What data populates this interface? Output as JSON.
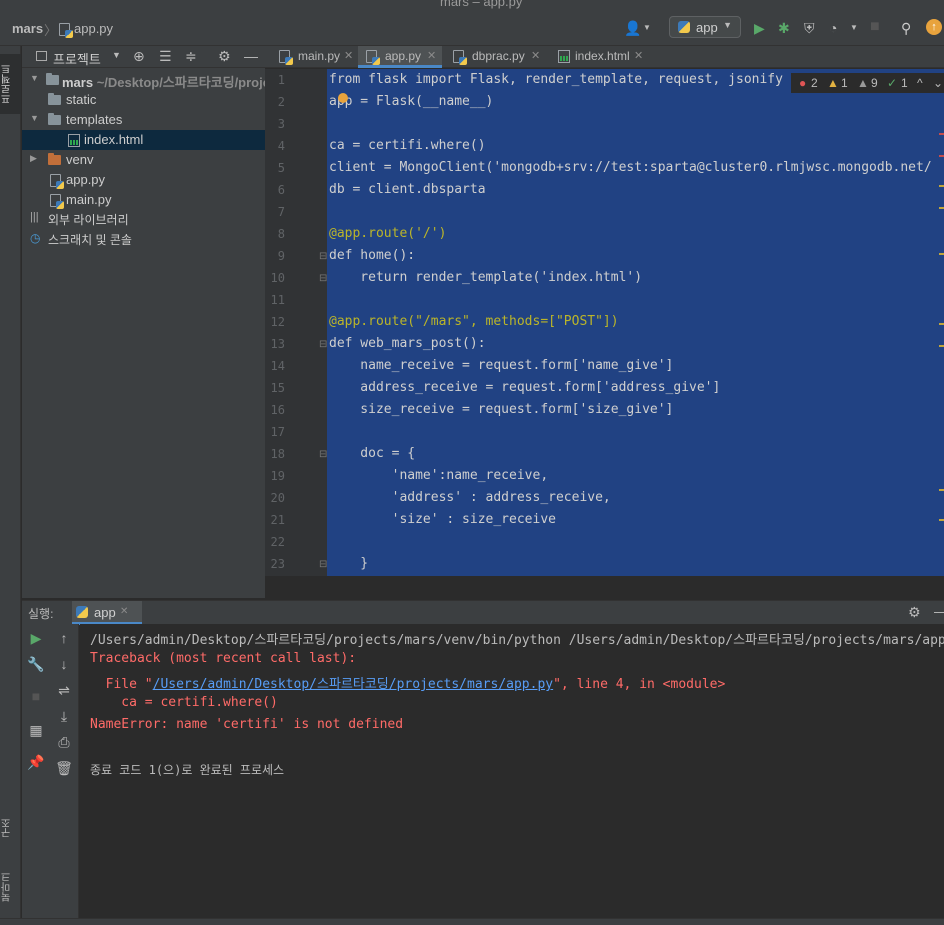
{
  "window": {
    "title": "mars – app.py"
  },
  "navbar": {
    "project": "mars",
    "file": "app.py",
    "run_config": "app"
  },
  "sidebar": {
    "tabs": {
      "project": "프로젝트",
      "structure": "구조",
      "bookmarks": "북마크"
    }
  },
  "project_panel": {
    "title": "프로젝트",
    "root": {
      "name": "mars",
      "path": "~/Desktop/스파르타코딩/project"
    },
    "items": [
      {
        "name": "static"
      },
      {
        "name": "templates"
      },
      {
        "name": "index.html"
      },
      {
        "name": "venv"
      },
      {
        "name": "app.py"
      },
      {
        "name": "main.py"
      },
      {
        "name": "외부 라이브러리"
      },
      {
        "name": "스크래치 및 콘솔"
      }
    ]
  },
  "editor": {
    "tabs": [
      {
        "label": "main.py"
      },
      {
        "label": "app.py"
      },
      {
        "label": "dbprac.py"
      },
      {
        "label": "index.html"
      }
    ],
    "inspections": {
      "errors": "2",
      "warnings": "1",
      "weak_warnings": "9",
      "typos": "1"
    },
    "line_numbers": [
      "1",
      "2",
      "3",
      "4",
      "5",
      "6",
      "7",
      "8",
      "9",
      "10",
      "11",
      "12",
      "13",
      "14",
      "15",
      "16",
      "17",
      "18",
      "19",
      "20",
      "21",
      "22",
      "23"
    ],
    "code": [
      "from flask import Flask, render_template, request, jsonify",
      "app = Flask(__name__)",
      "",
      "ca = certifi.where()",
      "client = MongoClient('mongodb+srv://test:sparta@cluster0.rlmjwsc.mongodb.net/",
      "db = client.dbsparta",
      "",
      "@app.route('/')",
      "def home():",
      "    return render_template('index.html')",
      "",
      "@app.route(\"/mars\", methods=[\"POST\"])",
      "def web_mars_post():",
      "    name_receive = request.form['name_give']",
      "    address_receive = request.form['address_give']",
      "    size_receive = request.form['size_give']",
      "",
      "    doc = {",
      "        'name':name_receive,",
      "        'address' : address_receive,",
      "        'size' : size_receive",
      "",
      "    }"
    ]
  },
  "run_panel": {
    "label": "실행:",
    "tab": "app",
    "console": {
      "command": "/Users/admin/Desktop/스파르타코딩/projects/mars/venv/bin/python /Users/admin/Desktop/스파르타코딩/projects/mars/app",
      "traceback": "Traceback (most recent call last):",
      "file_prefix": "  File \"",
      "file_link": "/Users/admin/Desktop/스파르타코딩/projects/mars/app.py",
      "file_suffix": "\", line 4, in <module>",
      "code_line": "    ca = certifi.where()",
      "error": "NameError: name 'certifi' is not defined",
      "exit_msg": "종료 코드 1(으)로 완료된 프로세스"
    }
  }
}
